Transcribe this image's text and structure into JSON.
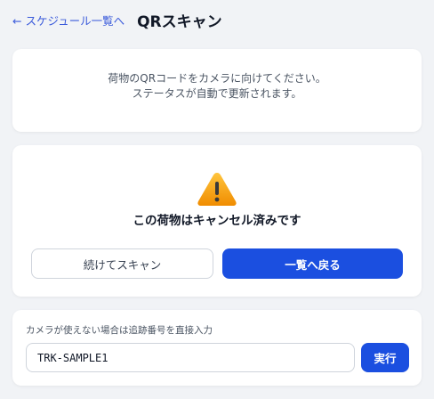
{
  "header": {
    "back_link": "← スケジュール一覧へ",
    "title": "QRスキャン"
  },
  "instruction": {
    "line1": "荷物のQRコードをカメラに向けてください。",
    "line2": "ステータスが自動で更新されます。"
  },
  "result": {
    "icon": "warning-icon",
    "message": "この荷物はキャンセル済みです",
    "continue_label": "続けてスキャン",
    "back_label": "一覧へ戻る"
  },
  "manual": {
    "label": "カメラが使えない場合は追跡番号を直接入力",
    "input_value": "TRK-SAMPLE1",
    "submit_label": "実行"
  },
  "colors": {
    "accent": "#1b4fe0",
    "link": "#3b5bdb",
    "warning": "#f59f00",
    "background": "#f1f3f6"
  }
}
